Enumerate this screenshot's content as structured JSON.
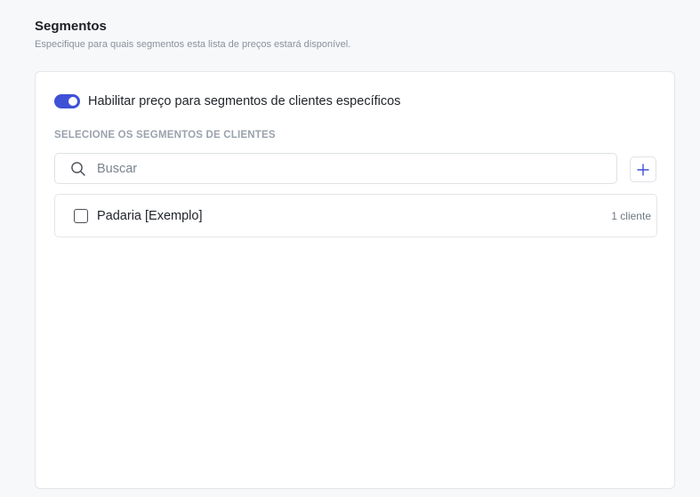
{
  "section": {
    "title": "Segmentos",
    "subtitle": "Especifique para quais segmentos esta lista de preços estará disponível."
  },
  "toggle": {
    "label": "Habilitar preço para segmentos de clientes específicos",
    "enabled": true
  },
  "segments": {
    "caption": "SELECIONE OS SEGMENTOS DE CLIENTES",
    "search_placeholder": "Buscar",
    "search_value": "",
    "items": [
      {
        "label": "Padaria [Exemplo]",
        "count": "1 cliente",
        "checked": false
      }
    ]
  },
  "colors": {
    "accent": "#3f51d6",
    "page_background": "#f7f8fa",
    "card_background": "#ffffff",
    "border": "#e3e6ea"
  },
  "icons": {
    "search": "search-icon",
    "add": "plus-icon"
  }
}
